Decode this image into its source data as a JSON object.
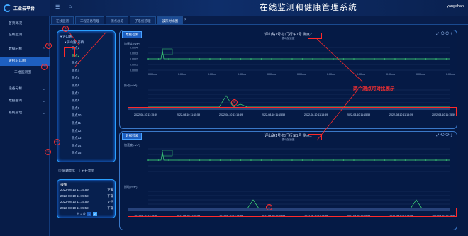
{
  "app": {
    "name": "工业云平台",
    "title": "在线监测和健康管理系统",
    "user": "yangshan"
  },
  "tabs": [
    "在线监测",
    "工程信息管理",
    "测点总览",
    "子系统管理",
    "波形对比图"
  ],
  "tabs_active": 4,
  "sidebar": {
    "items": [
      "首页概况",
      "在线监测",
      "数据分析",
      "波形对比图",
      "三维监测图",
      "设备分析",
      "数据查询",
      "系统管理"
    ],
    "active": 3
  },
  "tree": {
    "root": "评山路",
    "group": "评山路1号桥",
    "items": [
      "测点1",
      "测点2",
      "测点3",
      "测点4",
      "测点5",
      "测点6",
      "测点7",
      "测点8",
      "测点9",
      "测点10",
      "测点11",
      "测点12",
      "测点13",
      "测点14",
      "测点15"
    ],
    "selected": 1
  },
  "options": {
    "opt1": "同轴显示",
    "opt2": "分开显示"
  },
  "alarm": {
    "title": "报警",
    "rows": [
      {
        "time": "2022-08-10 11:15:59",
        "level": "下载"
      },
      {
        "time": "2022-08-10 11:15:59",
        "level": "下载"
      },
      {
        "time": "2022-08-10 11:15:59",
        "level": "1-区"
      },
      {
        "time": "2022-08-10 11:15:59",
        "level": "下载"
      }
    ],
    "pager": {
      "total": "共 2 条",
      "pages": [
        "1",
        "2"
      ]
    }
  },
  "chart1": {
    "label": "数据检索",
    "title": "评山路1号-加门行车1号 测点2",
    "subtitle": "振动加速度",
    "ylabel1": "加速度(m/s²)",
    "ylabel2": "振动(m/s²)",
    "yticks": [
      "0.0004",
      "0.0003",
      "0.0002",
      "0.0001",
      "0.0000"
    ],
    "xticks": [
      "0.00ms",
      "0.00ms",
      "0.00ms",
      "0.00ms",
      "0.00ms",
      "0.00ms",
      "0.00ms",
      "0.00ms",
      "0.00ms",
      "0.00ms",
      "0.00ms"
    ],
    "dates": [
      "2022-08-10 11:15:59",
      "2022-08-10 11:15:59",
      "2022-08-10 11:15:59",
      "2022-08-10 11:15:59",
      "2022-08-10 11:15:59",
      "2022-08-10 11:15:59",
      "2022-08-10 11:15:59",
      "2022-08-10 11:15:59"
    ]
  },
  "chart2": {
    "label": "数据检索",
    "title": "评山路1号-加门行车1号 测点1",
    "subtitle": "振动加速度",
    "ylabel1": "加速度(m/s²)",
    "ylabel2": "振动(m/s²)",
    "dates": [
      "2022-08-10 11:15:59",
      "2022-08-10 11:15:59",
      "2022-08-10 11:15:59",
      "2022-08-10 11:15:59",
      "2022-08-10 11:15:59",
      "2022-08-10 11:15:59",
      "2022-08-10 11:15:59",
      "2022-08-10 11:15:59"
    ]
  },
  "annotations": {
    "n1": "①",
    "n2": "②",
    "n3": "③",
    "n4": "④",
    "n5": "⑤",
    "n6": "⑥",
    "n7": "⑦",
    "note": "两个测点可对比展示"
  },
  "watermark": "",
  "colors": {
    "accent": "#2aa0ff",
    "line": "#41e07a",
    "annotation": "#ff2a2a"
  }
}
